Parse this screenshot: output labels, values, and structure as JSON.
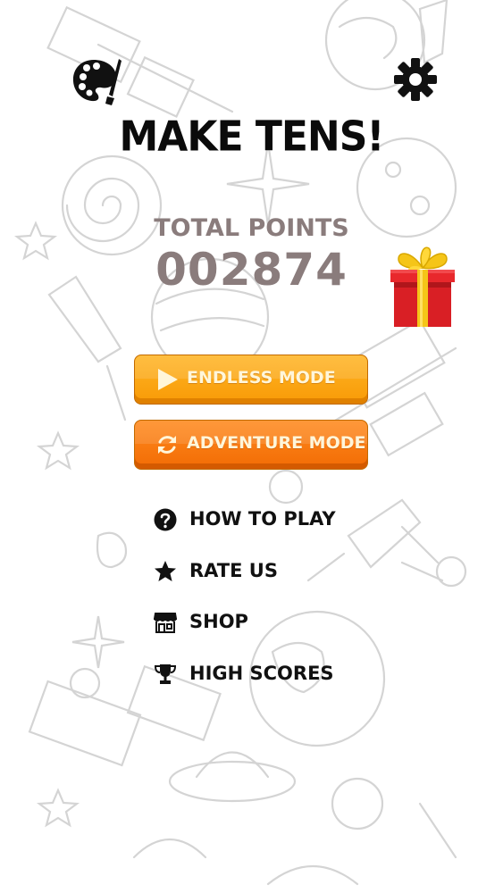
{
  "game": {
    "title": "MAKE TENS!",
    "total_points_label": "TOTAL POINTS",
    "total_points_value": "002874"
  },
  "top_bar": {
    "left_icon": "palette-icon",
    "right_icon": "gear-icon"
  },
  "bonus": {
    "icon": "gift-icon"
  },
  "modes": [
    {
      "label": "ENDLESS MODE",
      "icon": "play-icon",
      "color": "#f9a20a"
    },
    {
      "label": "ADVENTURE MODE",
      "icon": "refresh-icon",
      "color": "#f47508"
    }
  ],
  "menu": [
    {
      "label": "HOW TO PLAY",
      "icon": "help-icon"
    },
    {
      "label": "RATE US",
      "icon": "star-icon"
    },
    {
      "label": "SHOP",
      "icon": "shop-icon"
    },
    {
      "label": "HIGH SCORES",
      "icon": "trophy-icon"
    }
  ],
  "colors": {
    "title": "#0b0b0b",
    "points": "#8a7c7c",
    "doodle_stroke": "#cfcfcf"
  }
}
